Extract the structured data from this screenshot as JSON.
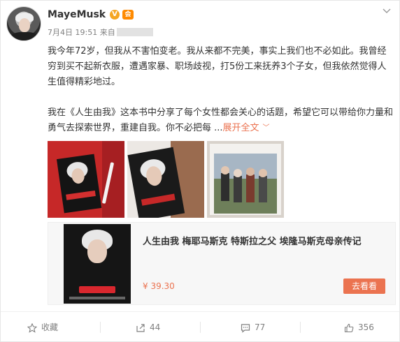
{
  "user": {
    "name": "MayeMusk",
    "verified_badge": "V",
    "vip_badge": "会"
  },
  "meta": {
    "date": "7月4日",
    "time": "19:51",
    "source_prefix": "来自"
  },
  "post": {
    "paragraph1": "我今年72岁，但我从不害怕变老。我从来都不完美，事实上我们也不必如此。我曾经穷到买不起新衣服，遭遇家暴、职场歧视，打5份工来抚养3个子女，但我依然觉得人生值得精彩地过。",
    "paragraph2": "我在《人生由我》这本书中分享了每个女性都会关心的话题，希望它可以带给你力量和勇气去探索世界，重建自我。你不必把每 ...",
    "expand_label": "展开全文",
    "expand_chevron": "﹀"
  },
  "product": {
    "title": "人生由我 梅耶马斯克 特斯拉之父 埃隆马斯克母亲传记",
    "price": "¥ 39.30",
    "buy_label": "去看看"
  },
  "actions": {
    "favorite_label": "收藏",
    "repost_count": "44",
    "comment_count": "77",
    "like_count": "356"
  },
  "icons": [
    "more-icon",
    "star-icon",
    "repost-icon",
    "comment-icon",
    "like-icon",
    "chevron-down-icon"
  ],
  "colors": {
    "accent": "#eb7350",
    "text": "#333333",
    "muted": "#808080"
  }
}
